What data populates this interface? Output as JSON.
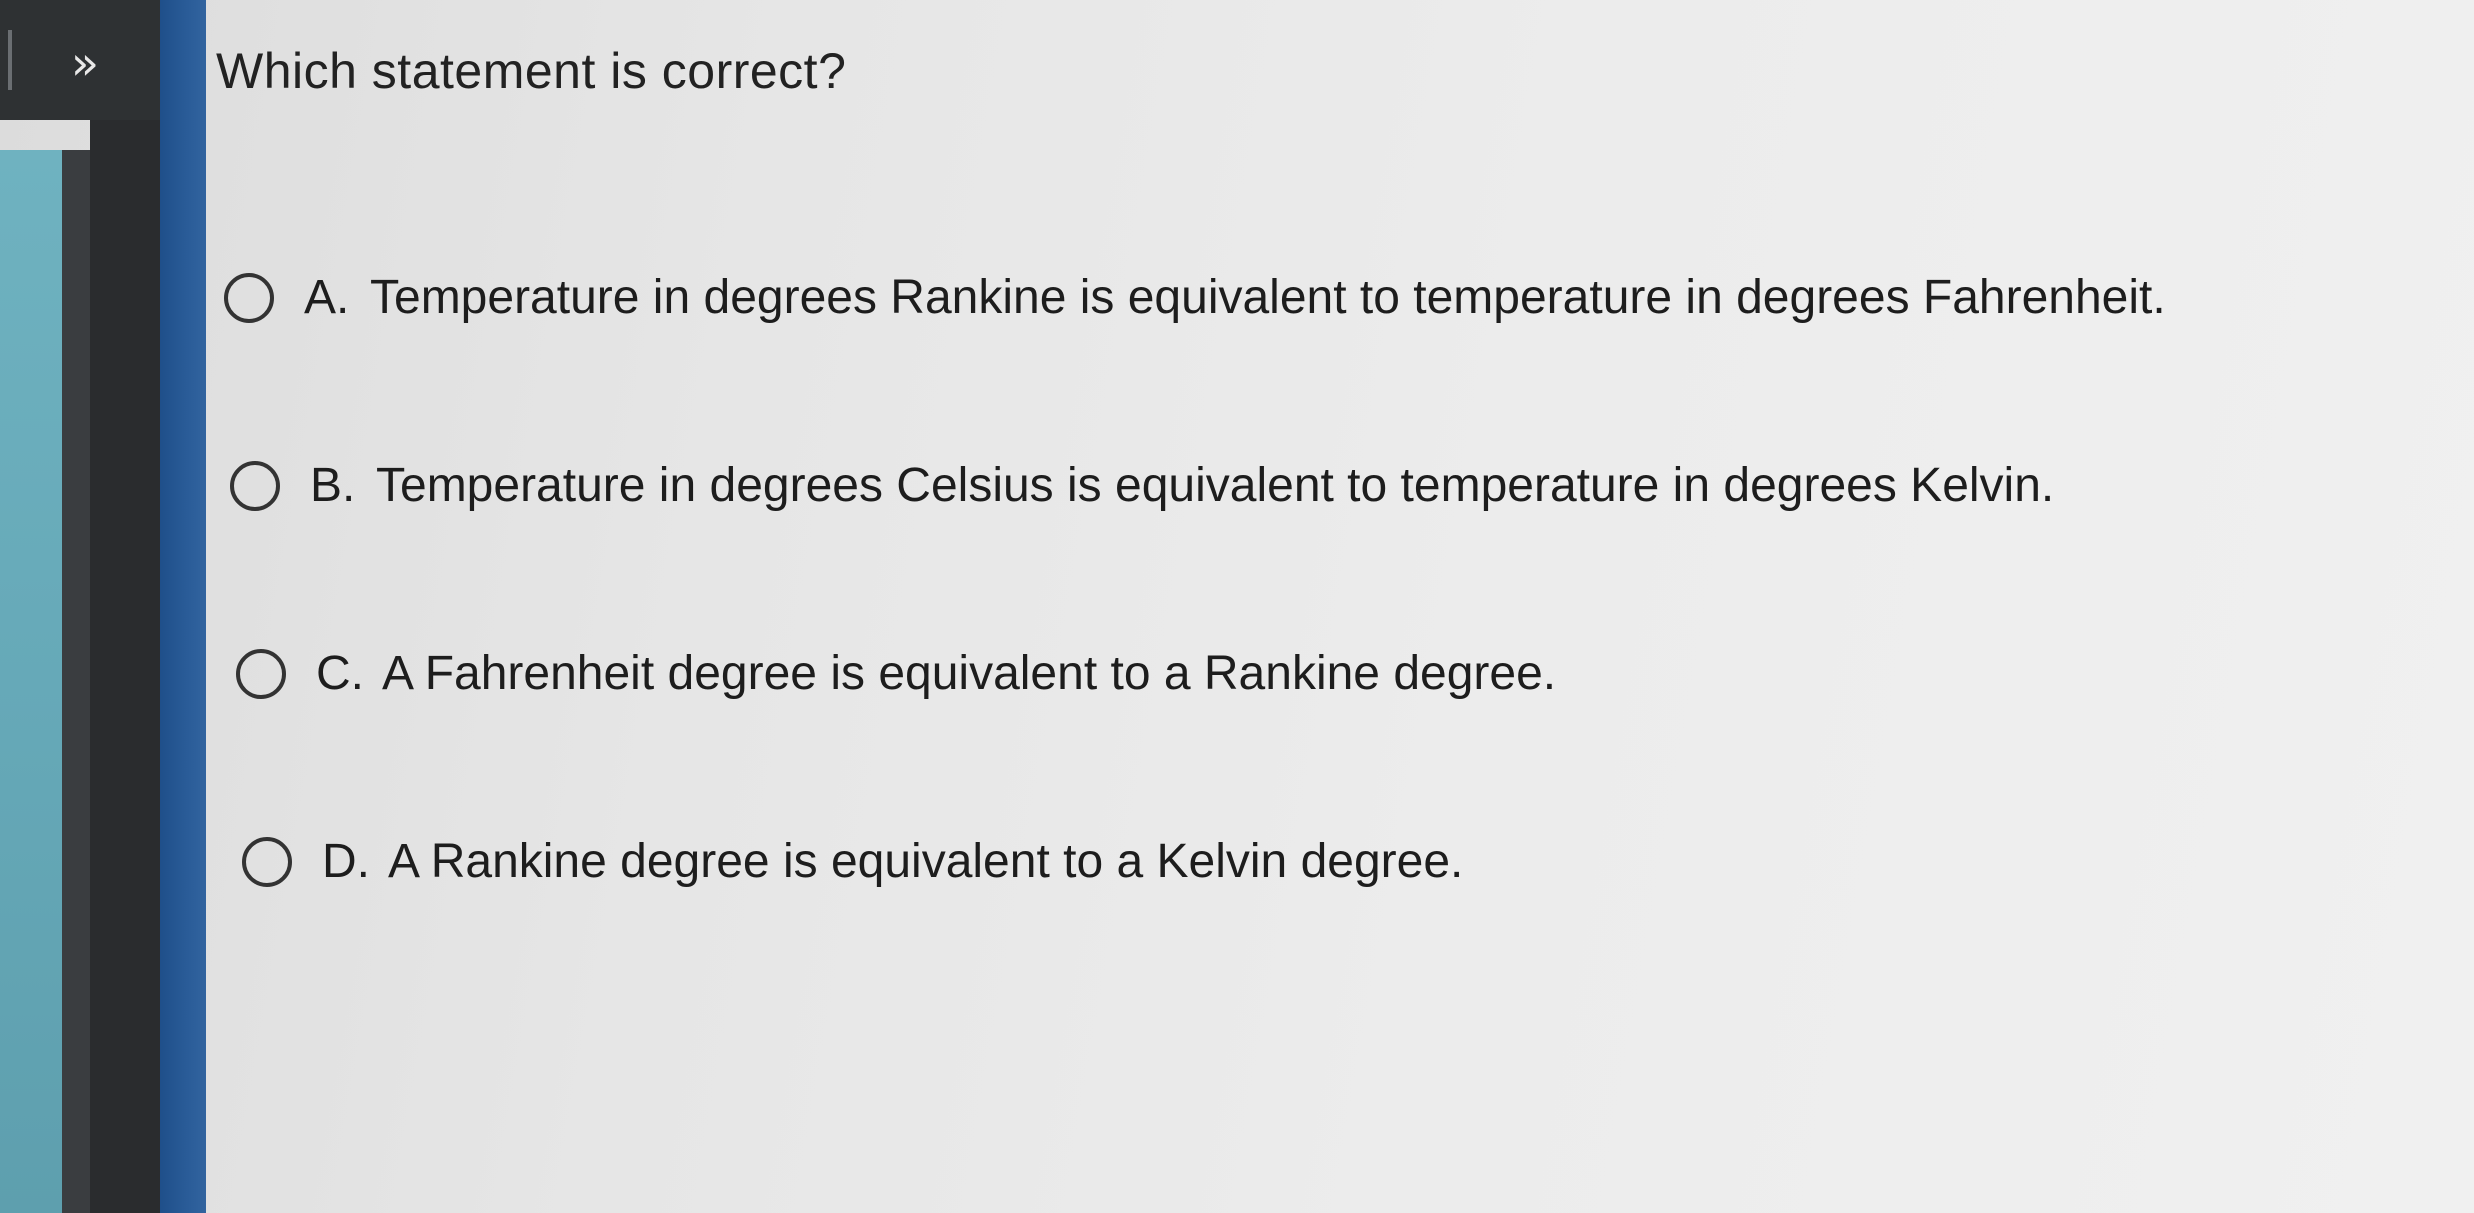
{
  "sidebar": {
    "collapse_label": "»"
  },
  "question": {
    "title": "Which statement is correct?",
    "options": [
      {
        "letter": "A.",
        "text": "Temperature in degrees Rankine is equivalent to temperature in degrees Fahrenheit."
      },
      {
        "letter": "B.",
        "text": "Temperature in degrees Celsius is equivalent to temperature in degrees Kelvin."
      },
      {
        "letter": "C.",
        "text": "A Fahrenheit degree is equivalent to a Rankine degree."
      },
      {
        "letter": "D.",
        "text": "A Rankine degree is equivalent to a Kelvin degree."
      }
    ]
  }
}
